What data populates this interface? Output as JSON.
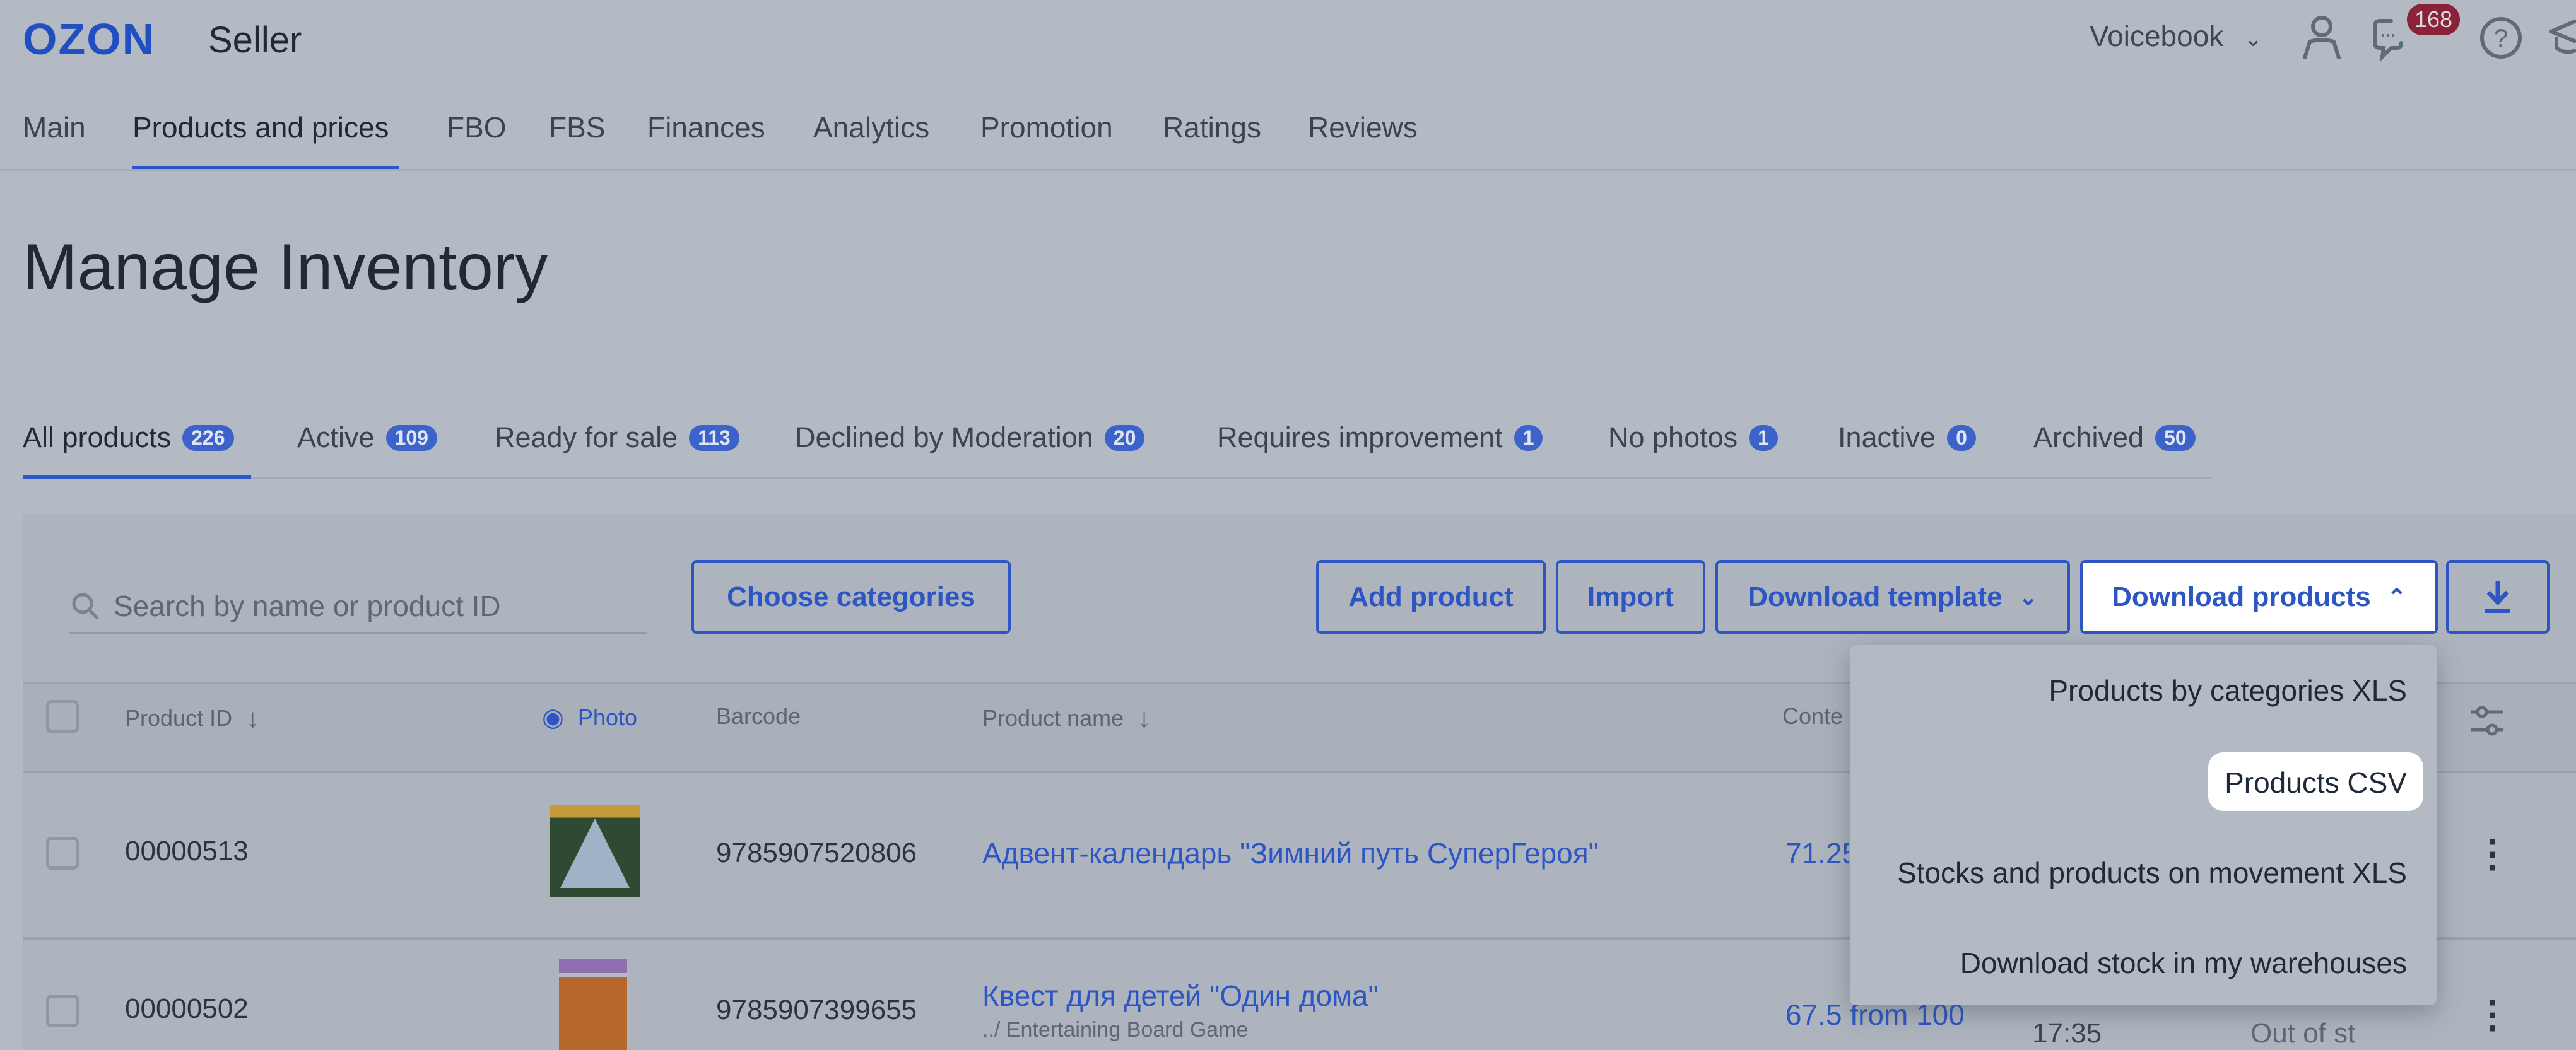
{
  "header": {
    "logo": "OZON",
    "logo_suffix": "Seller",
    "account": "Voicebook",
    "messages_count": "168"
  },
  "nav": [
    "Main",
    "Products and prices",
    "FBO",
    "FBS",
    "Finances",
    "Analytics",
    "Promotion",
    "Ratings",
    "Reviews"
  ],
  "page_title": "Manage Inventory",
  "status_tabs": [
    {
      "label": "All products",
      "count": "226"
    },
    {
      "label": "Active",
      "count": "109"
    },
    {
      "label": "Ready for sale",
      "count": "113"
    },
    {
      "label": "Declined by Moderation",
      "count": "20"
    },
    {
      "label": "Requires improvement",
      "count": "1"
    },
    {
      "label": "No photos",
      "count": "1"
    },
    {
      "label": "Inactive",
      "count": "0"
    },
    {
      "label": "Archived",
      "count": "50"
    }
  ],
  "toolbar": {
    "search_placeholder": "Search by name or product ID",
    "choose_categories": "Choose categories",
    "add_product": "Add product",
    "import": "Import",
    "download_template": "Download template",
    "download_products": "Download products"
  },
  "table": {
    "columns": {
      "product_id": "Product ID",
      "photo": "Photo",
      "barcode": "Barcode",
      "product_name": "Product name",
      "content": "Conte"
    },
    "rows": [
      {
        "id": "00000513",
        "barcode": "9785907520806",
        "name": "Адвент-календарь \"Зимний путь СуперГероя\"",
        "category": "",
        "content": "71.25",
        "time": "",
        "stock": ""
      },
      {
        "id": "00000502",
        "barcode": "9785907399655",
        "name": "Квест для детей \"Один дома\"",
        "category": "../ Entertaining Board Game",
        "content": "67.5 from 100",
        "time": "17:35",
        "stock": "Out of st"
      }
    ]
  },
  "dropdown": {
    "items": [
      "Products by categories XLS",
      "Products CSV",
      "Stocks and products on movement XLS",
      "Download stock in my warehouses"
    ],
    "highlighted": "Products CSV"
  },
  "colors": {
    "accent": "#2d56c4",
    "badge_alert": "#8a2238",
    "overlay_bg": "#b3bac3"
  }
}
